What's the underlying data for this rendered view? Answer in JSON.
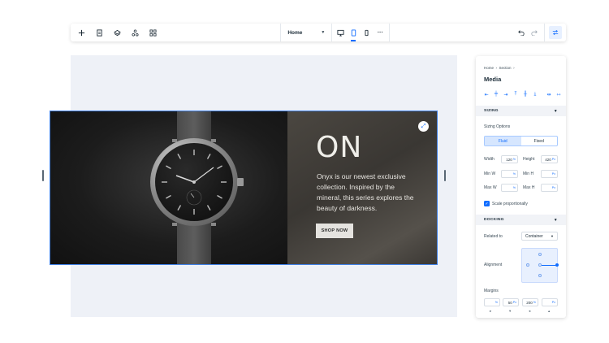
{
  "toolbar": {
    "left_icons": [
      "add-icon",
      "pages-icon",
      "layers-icon",
      "components-icon",
      "apps-grid-icon"
    ],
    "page_select": {
      "value": "Home"
    },
    "devices": [
      "desktop-icon",
      "tablet-icon",
      "mobile-icon"
    ],
    "active_device": "tablet-icon",
    "more": "···",
    "right_icons": [
      "undo-icon",
      "redo-icon",
      "inspector-toggle-icon"
    ]
  },
  "hero": {
    "title": "ON",
    "description": "Onyx is our newest exclusive collection. Inspired by the mineral, this series explores the beauty of darkness.",
    "button": "SHOP NOW"
  },
  "inspector": {
    "breadcrumb": [
      "Home",
      "Section"
    ],
    "title": "Media",
    "sizing": {
      "header": "SIZING",
      "options_label": "Sizing Options",
      "fluid": "Fluid",
      "fixed": "Fixed",
      "width_label": "Width",
      "width_value": "120",
      "width_unit": "%",
      "height_label": "Height",
      "height_value": "420",
      "height_unit": "Px",
      "minw_label": "Min W",
      "minw_unit": "%",
      "minh_label": "Min H",
      "minh_unit": "Px",
      "maxw_label": "Max W",
      "maxw_unit": "%",
      "maxh_label": "Max H",
      "maxh_unit": "Px",
      "scale_label": "Scale proportionally"
    },
    "docking": {
      "header": "DOCKING",
      "related_label": "Related to",
      "related_value": "Container",
      "alignment_label": "Alignment",
      "margins_label": "Margins",
      "margin_values": [
        {
          "value": "",
          "unit": "%"
        },
        {
          "value": "50",
          "unit": "Px"
        },
        {
          "value": "200",
          "unit": "%"
        },
        {
          "value": "",
          "unit": "Px"
        }
      ]
    }
  },
  "colors": {
    "accent": "#116dff",
    "canvas": "#eef1f7",
    "selection": "#3f80e6"
  }
}
